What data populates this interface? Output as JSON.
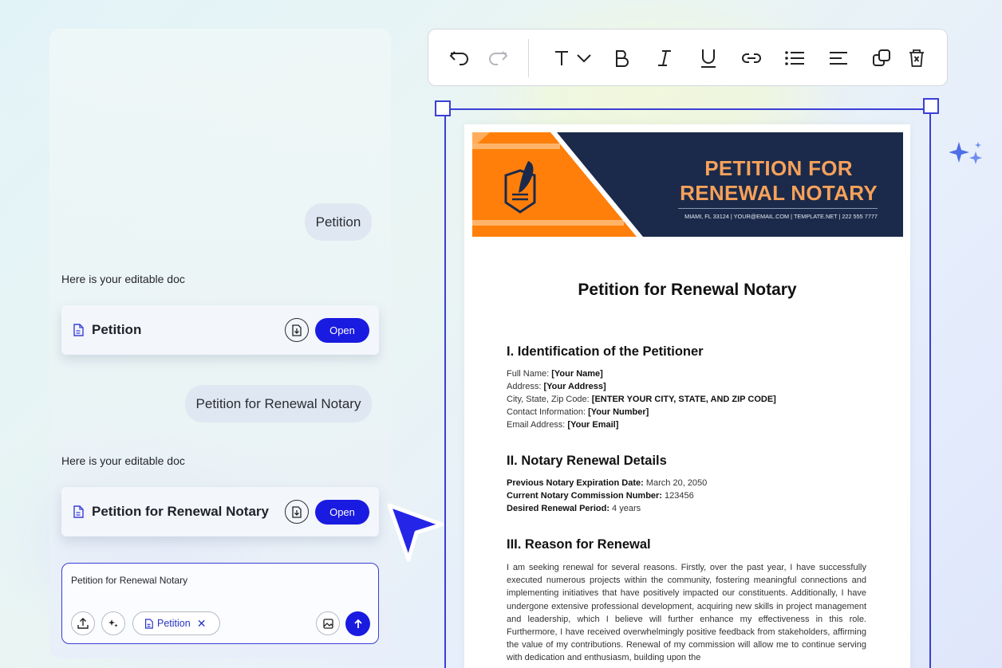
{
  "chat": {
    "messages": [
      {
        "role": "user",
        "text": "Petition"
      },
      {
        "role": "assistant",
        "text": "Here is your editable doc"
      },
      {
        "role": "user",
        "text": "Petition for Renewal Notary"
      },
      {
        "role": "assistant",
        "text": "Here is your editable doc"
      }
    ],
    "cards": [
      {
        "title": "Petition",
        "open_label": "Open"
      },
      {
        "title": "Petition for Renewal Notary",
        "open_label": "Open"
      }
    ],
    "composer": {
      "value": "Petition for Renewal Notary",
      "chip_label": "Petition"
    }
  },
  "toolbar": {
    "icons": [
      "undo-icon",
      "redo-icon",
      "text-style-icon",
      "chevron-down-icon",
      "bold-icon",
      "italic-icon",
      "underline-icon",
      "link-icon",
      "bullet-list-icon",
      "align-left-icon",
      "duplicate-icon",
      "delete-icon"
    ]
  },
  "document": {
    "banner": {
      "title_line1": "PETITION FOR",
      "title_line2": "RENEWAL NOTARY",
      "contact": "MIAMI, FL 33124 | YOUR@EMAIL.COM | TEMPLATE.NET | 222 555 7777"
    },
    "title": "Petition for Renewal Notary",
    "section1": {
      "heading": "I. Identification of the Petitioner",
      "rows": [
        {
          "label": "Full Name: ",
          "value": "[Your Name]"
        },
        {
          "label": "Address: ",
          "value": "[Your Address]"
        },
        {
          "label": "City, State, Zip Code: ",
          "value": "[ENTER YOUR CITY, STATE, AND ZIP CODE]"
        },
        {
          "label": "Contact Information: ",
          "value": "[Your Number]"
        },
        {
          "label": "Email Address: ",
          "value": "[Your Email]"
        }
      ]
    },
    "section2": {
      "heading": "II. Notary Renewal Details",
      "rows": [
        {
          "label": "Previous Notary Expiration Date:",
          "value": " March 20, 2050"
        },
        {
          "label": "Current Notary Commission Number:",
          "value": " 123456"
        },
        {
          "label": "Desired Renewal Period:",
          "value": " 4 years"
        }
      ]
    },
    "section3": {
      "heading": "III. Reason for Renewal",
      "body": "I am seeking renewal for several reasons. Firstly, over the past year, I have successfully executed numerous projects within the community, fostering meaningful connections and implementing initiatives that have positively impacted our constituents. Additionally, I have undergone extensive professional development, acquiring new skills in project management and leadership, which I believe will further enhance my effectiveness in this role. Furthermore, I have received overwhelmingly positive feedback from stakeholders, affirming the value of my contributions. Renewal of my commission will allow me to continue serving with dedication and enthusiasm, building upon the"
    }
  },
  "colors": {
    "accent": "#1a1be0",
    "selection": "#3b3fd6",
    "banner_navy": "#1b2a4a",
    "banner_orange": "#ff7f0a"
  }
}
